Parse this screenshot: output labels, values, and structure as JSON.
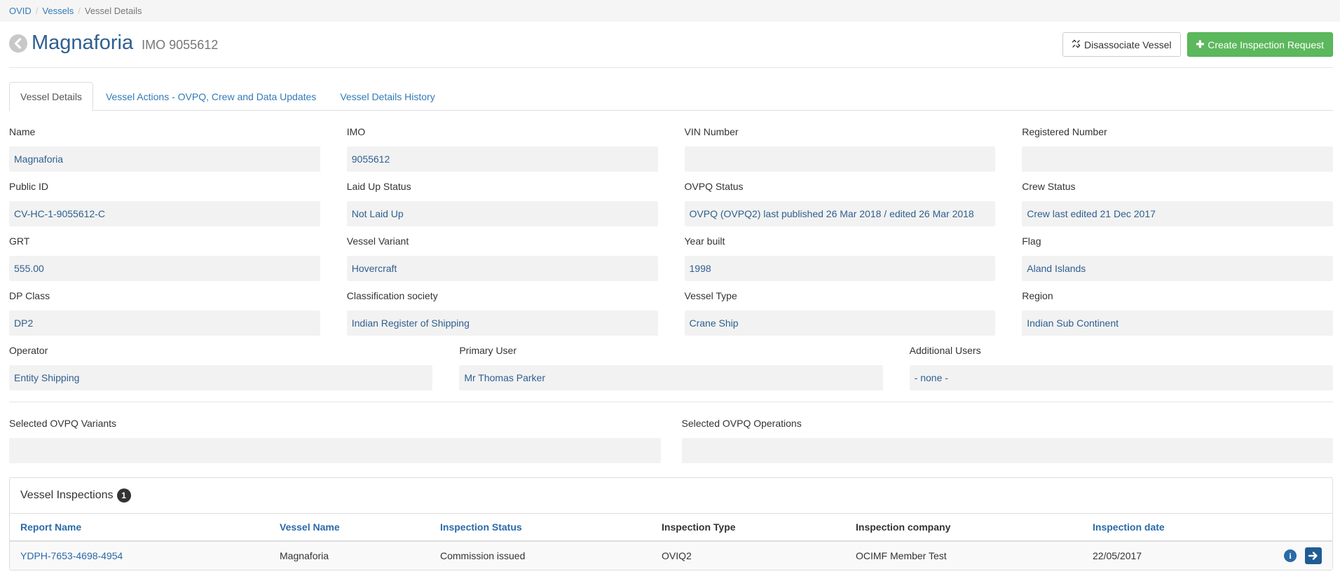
{
  "breadcrumb": {
    "items": [
      "OVID",
      "Vessels"
    ],
    "current": "Vessel Details"
  },
  "header": {
    "vessel_name": "Magnaforia",
    "imo_label": "IMO 9055612",
    "disassociate_label": "Disassociate Vessel",
    "create_label": "Create Inspection Request"
  },
  "tabs": [
    {
      "label": "Vessel Details"
    },
    {
      "label": "Vessel Actions - OVPQ, Crew and Data Updates"
    },
    {
      "label": "Vessel Details History"
    }
  ],
  "fields": {
    "name": {
      "label": "Name",
      "value": "Magnaforia"
    },
    "imo": {
      "label": "IMO",
      "value": "9055612"
    },
    "vin": {
      "label": "VIN Number",
      "value": ""
    },
    "registered_number": {
      "label": "Registered Number",
      "value": ""
    },
    "public_id": {
      "label": "Public ID",
      "value": "CV-HC-1-9055612-C"
    },
    "laid_up_status": {
      "label": "Laid Up Status",
      "value": "Not Laid Up"
    },
    "ovpq_status": {
      "label": "OVPQ Status",
      "value": "OVPQ (OVPQ2) last published 26 Mar 2018 / edited 26 Mar 2018"
    },
    "crew_status": {
      "label": "Crew Status",
      "value": "Crew last edited 21 Dec 2017"
    },
    "grt": {
      "label": "GRT",
      "value": "555.00"
    },
    "vessel_variant": {
      "label": "Vessel Variant",
      "value": "Hovercraft"
    },
    "year_built": {
      "label": "Year built",
      "value": "1998"
    },
    "flag": {
      "label": "Flag",
      "value": "Aland Islands"
    },
    "dp_class": {
      "label": "DP Class",
      "value": "DP2"
    },
    "classification_society": {
      "label": "Classification society",
      "value": "Indian Register of Shipping"
    },
    "vessel_type": {
      "label": "Vessel Type",
      "value": "Crane Ship"
    },
    "region": {
      "label": "Region",
      "value": "Indian Sub Continent"
    },
    "operator": {
      "label": "Operator",
      "value": "Entity Shipping"
    },
    "primary_user": {
      "label": "Primary User",
      "value": "Mr Thomas Parker"
    },
    "additional_users": {
      "label": "Additional Users",
      "value": "- none -"
    },
    "ovpq_variants": {
      "label": "Selected OVPQ Variants",
      "value": ""
    },
    "ovpq_operations": {
      "label": "Selected OVPQ Operations",
      "value": ""
    }
  },
  "inspections": {
    "title": "Vessel Inspections",
    "count": "1",
    "columns": [
      "Report Name",
      "Vessel Name",
      "Inspection Status",
      "Inspection Type",
      "Inspection company",
      "Inspection date"
    ],
    "rows": [
      {
        "report_name": "YDPH-7653-4698-4954",
        "vessel_name": "Magnaforia",
        "status": "Commission issued",
        "type": "OVIQ2",
        "company": "OCIMF Member Test",
        "date": "22/05/2017"
      }
    ]
  },
  "colors": {
    "link": "#337ab7",
    "value_text": "#2f5f8f",
    "success": "#5cb85c",
    "field_bg": "#f2f2f2"
  },
  "icons": {
    "back": "chevron-left-circle-icon",
    "disassociate": "unlink-icon",
    "create": "plus-icon",
    "info": "info-circle-icon",
    "go": "arrow-right-icon"
  }
}
